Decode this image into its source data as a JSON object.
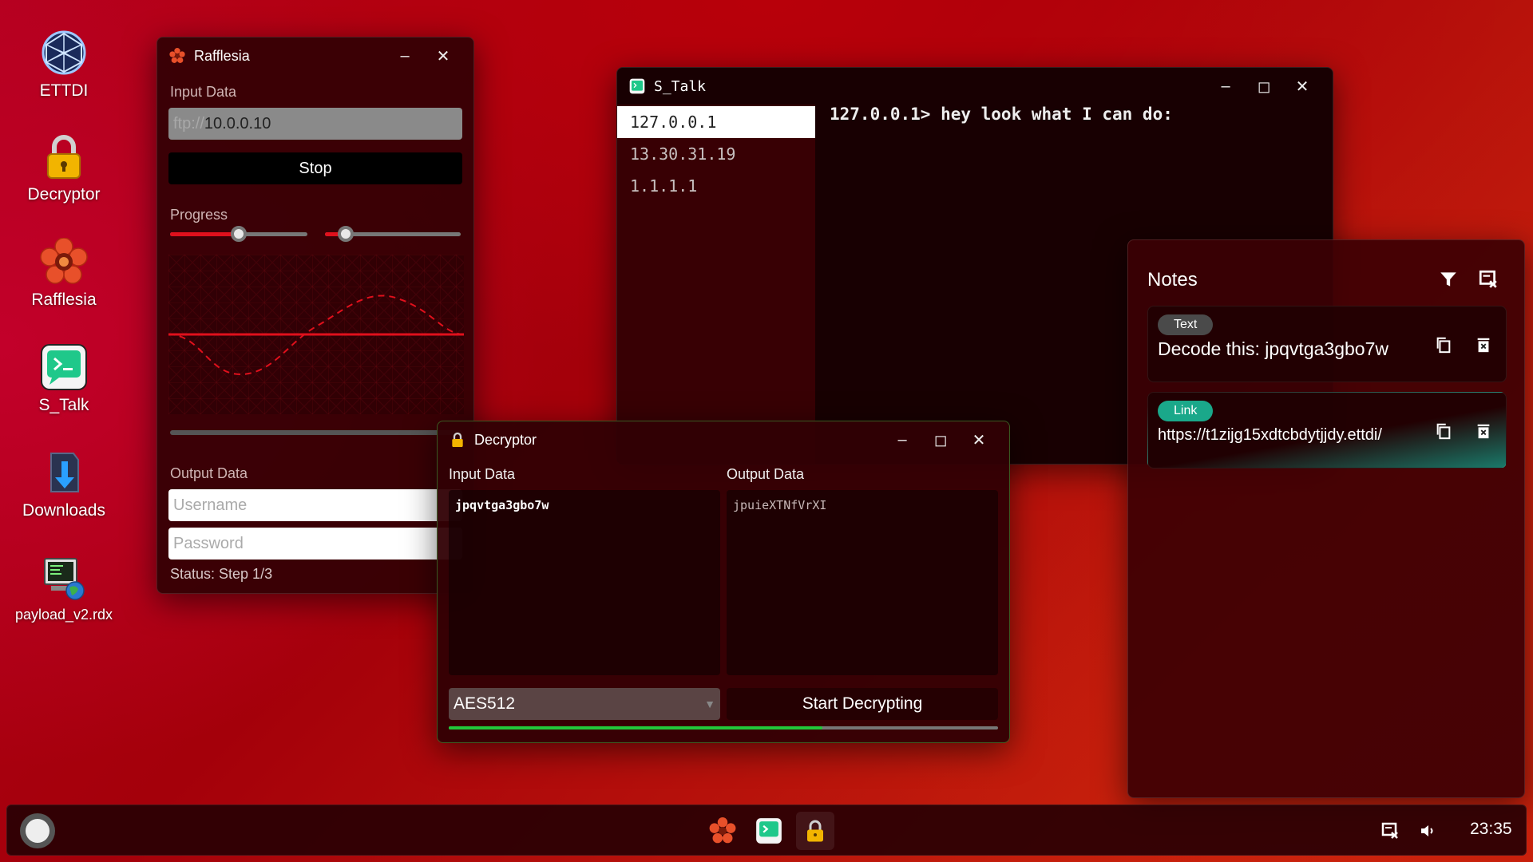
{
  "desktop": {
    "icons": [
      {
        "label": "ETTDI",
        "icon": "network-globe-icon"
      },
      {
        "label": "Decryptor",
        "icon": "padlock-icon"
      },
      {
        "label": "Rafflesia",
        "icon": "rafflesia-flower-icon"
      },
      {
        "label": "S_Talk",
        "icon": "terminal-chat-icon"
      },
      {
        "label": "Downloads",
        "icon": "download-folder-icon"
      },
      {
        "label": "payload_v2.rdx",
        "icon": "payload-file-icon"
      }
    ]
  },
  "rafflesia": {
    "title": "Rafflesia",
    "input_label": "Input Data",
    "input_prefix": "ftp://",
    "input_value": "10.0.0.10",
    "stop_label": "Stop",
    "progress_label": "Progress",
    "slider1_level": 0.5,
    "slider2_level": 0.15,
    "output_label": "Output Data",
    "username_placeholder": "Username",
    "password_placeholder": "Password",
    "status": "Status: Step 1/3"
  },
  "stalk": {
    "title": "S_Talk",
    "peers": [
      "127.0.0.1",
      "13.30.31.19",
      "1.1.1.1"
    ],
    "selected_peer": 0,
    "messages": [
      "127.0.0.1> hey look what I can do:"
    ]
  },
  "notes": {
    "title": "Notes",
    "items": [
      {
        "tag": "Text",
        "text": "Decode this: jpqvtga3gbo7w"
      },
      {
        "tag": "Link",
        "text": "https://t1zijg15xdtcbdytjjdy.ettdi/"
      }
    ]
  },
  "decryptor": {
    "title": "Decryptor",
    "input_label": "Input Data",
    "output_label": "Output Data",
    "input_value": "jpqvtga3gbo7w",
    "output_value": "jpuieXTNfVrXI",
    "algorithm": "AES512",
    "start_label": "Start Decrypting",
    "progress": 0.68
  },
  "taskbar": {
    "clock": "23:35",
    "apps": [
      "rafflesia-flower-icon",
      "terminal-chat-icon",
      "padlock-icon"
    ]
  },
  "colors": {
    "accent_red": "#e0101c",
    "progress_green": "#22c83a",
    "note_tag_text": "#4a4a4a",
    "note_tag_link": "#1aa88a"
  }
}
